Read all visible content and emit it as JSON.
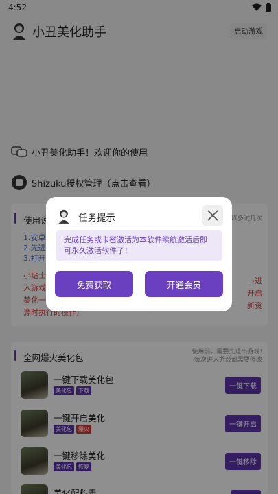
{
  "status": {
    "time": "4:52"
  },
  "app": {
    "title": "小丑美化助手",
    "launch_label": "启动游戏"
  },
  "welcome": "小丑美化助手！欢迎你的使用",
  "shizuku": "Shizuku授权管理（点击查看）",
  "usage": {
    "header": "使用说",
    "note": "以多试几次",
    "steps": [
      "1.安卓",
      "2.先进",
      "3.打开"
    ],
    "tip": [
      "小贴士",
      "入游戏",
      "美化一",
      "源时执行的操作)"
    ],
    "tip_right": [
      "→进",
      "开启",
      "新资"
    ]
  },
  "section": {
    "header": "全网爆火美化包",
    "note": [
      "使用前，需要先退出游戏!",
      "每次进入游戏都需要修改"
    ]
  },
  "packages": [
    {
      "name": "一键下载美化包",
      "tags": [
        {
          "text": "美化包",
          "color": "#5b33a8"
        },
        {
          "text": "下载",
          "color": "#5b33a8"
        }
      ],
      "button": "一键下载"
    },
    {
      "name": "一键开启美化",
      "tags": [
        {
          "text": "美化包",
          "color": "#5b33a8"
        },
        {
          "text": "爆火",
          "color": "#d03a3a"
        }
      ],
      "button": "一键开启"
    },
    {
      "name": "一键移除美化",
      "tags": [
        {
          "text": "美化包",
          "color": "#5b33a8"
        },
        {
          "text": "恢复",
          "color": "#5b33a8"
        }
      ],
      "button": "一键移除"
    },
    {
      "name": "美化配料表",
      "tags": [],
      "button": ""
    }
  ],
  "dialog": {
    "title": "任务提示",
    "message": "完成任务或卡密激活为本软件续航激活后即可永久激活软件了！",
    "btn_free": "免费获取",
    "btn_vip": "开通会员"
  },
  "colors": {
    "accent": "#6a3fc0",
    "accent_dark": "#5b33a8",
    "danger": "#d03a3a",
    "link": "#3a5fc8"
  }
}
